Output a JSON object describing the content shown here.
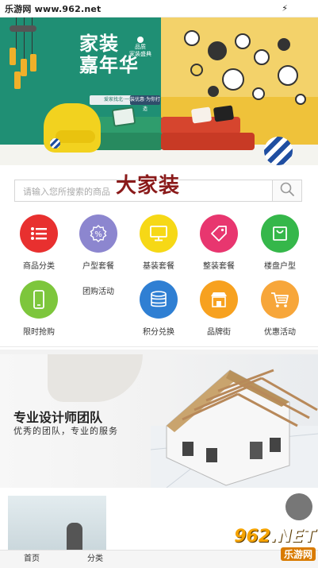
{
  "status_bar": {
    "watermark": "乐游网 www.962.net",
    "icon": "bolt-icon"
  },
  "hero": {
    "title_line1": "家装",
    "title_line2": "嘉年华",
    "tag_line1": "品质",
    "tag_line2": "家装盛典",
    "slogan_left": "爱家找北·一站式家",
    "slogan_right": "装优惠·为你打造",
    "colors": {
      "left": "#1f8f74",
      "right": "#efc23a"
    }
  },
  "search": {
    "placeholder": "请输入您所搜索的商品",
    "button_icon": "search-icon"
  },
  "brand_text": "大家装",
  "categories": [
    {
      "label": "商品分类",
      "icon": "list-icon",
      "color": "#e8302f"
    },
    {
      "label": "户型套餐",
      "icon": "percent-icon",
      "color": "#8c86cf"
    },
    {
      "label": "基装套餐",
      "icon": "monitor-icon",
      "color": "#f6d816"
    },
    {
      "label": "整装套餐",
      "icon": "tag-icon",
      "color": "#e8366f"
    },
    {
      "label": "楼盘户型",
      "icon": "bag-icon",
      "color": "#35b74a"
    },
    {
      "label": "限时抢购",
      "icon": "phone-icon",
      "color": "#7dc63c"
    },
    {
      "label": "积分兑换",
      "icon": "coin-stack-icon",
      "color": "#2f7fd3"
    },
    {
      "label": "品牌街",
      "icon": "shop-icon",
      "color": "#f7a11f"
    },
    {
      "label": "优惠活动",
      "icon": "cart-icon",
      "color": "#f7a63a"
    }
  ],
  "extra_label": "团购活动",
  "team_banner": {
    "title": "专业设计师团队",
    "subtitle": "优秀的团队，专业的服务"
  },
  "tabbar": {
    "home": "首页",
    "category": "分类"
  },
  "watermark_badge": {
    "number": "962",
    "net": ".NET",
    "site": "乐游网"
  }
}
